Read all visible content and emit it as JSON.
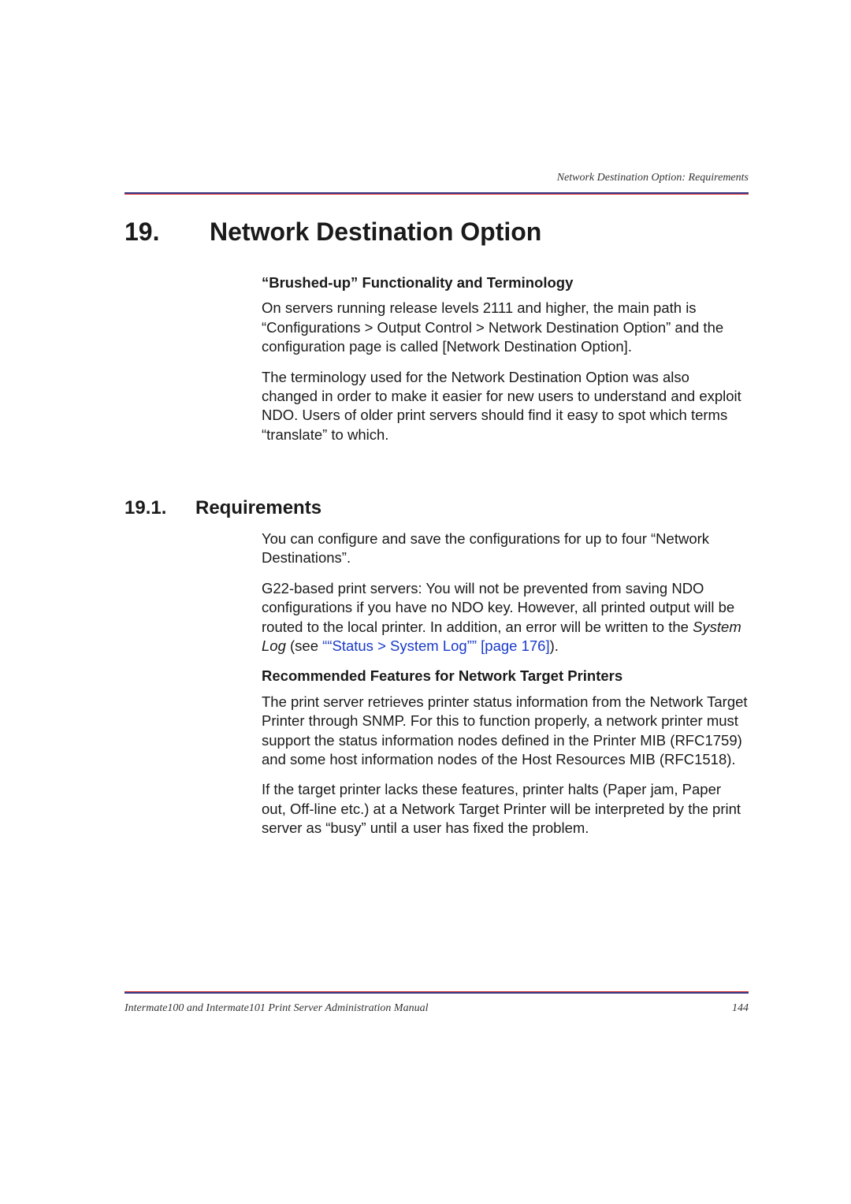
{
  "running_header": "Network Destination Option: Requirements",
  "chapter": {
    "number": "19.",
    "title": "Network Destination Option"
  },
  "intro": {
    "subhead": "“Brushed-up” Functionality and Terminology",
    "para1": "On servers running release levels 2111 and higher, the main path is “Configurations > Output Control > Network Destination Option” and the configuration page is called [Network Destination Option].",
    "para2": "The terminology used for the Network Destination Option was also changed in order to make it easier for new users to understand and exploit NDO. Users of older print servers should find it easy to spot which terms “translate” to which."
  },
  "section": {
    "number": "19.1.",
    "title": "Requirements",
    "para1": "You can configure and save the configurations for up to four “Network Destinations”.",
    "para2_pre": "G22-based print servers: You will not be prevented from saving NDO configurations if you have no NDO key. However, all printed output will be routed to the local printer. In addition, an error will be written to the ",
    "para2_italic": "System Log",
    "para2_mid": " (see ",
    "para2_link": "““Status > System Log”” [page 176]",
    "para2_end": ").",
    "subhead2": "Recommended Features for Network Target Printers",
    "para3": "The print server retrieves printer status information from the Network Target Printer through SNMP. For this to function properly, a network printer must support the status information nodes defined in the Printer MIB (RFC1759) and some host information nodes of the Host Resources MIB (RFC1518).",
    "para4": "If the target printer lacks these features, printer halts (Paper jam, Paper out, Off-line etc.) at a Network Target Printer will be interpreted by the print server as “busy” until a user has fixed the problem."
  },
  "footer": {
    "left": "Intermate100 and Intermate101 Print Server Administration Manual",
    "right": "144"
  }
}
